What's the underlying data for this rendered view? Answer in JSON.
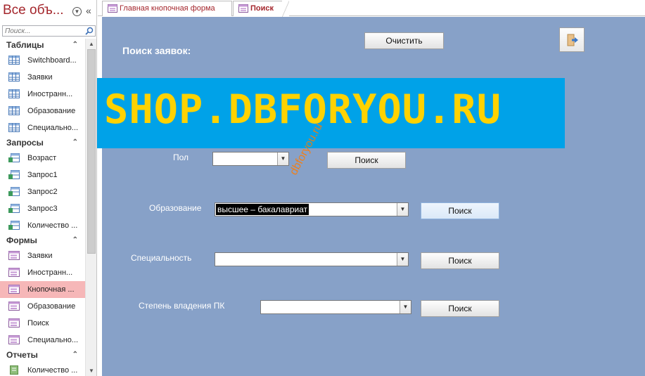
{
  "nav": {
    "title": "Все объ...",
    "search_placeholder": "Поиск...",
    "groups": [
      {
        "label": "Таблицы",
        "items": [
          "Switchboard...",
          "Заявки",
          "Иностранн...",
          "Образование",
          "Специально..."
        ]
      },
      {
        "label": "Запросы",
        "items": [
          "Возраст",
          "Запрос1",
          "Запрос2",
          "Запрос3",
          "Количество ..."
        ]
      },
      {
        "label": "Формы",
        "items": [
          "Заявки",
          "Иностранн...",
          "Кнопочная ...",
          "Образование",
          "Поиск",
          "Специально..."
        ]
      },
      {
        "label": "Отчеты",
        "items": [
          "Количество ..."
        ]
      }
    ],
    "selected_item": "Кнопочная ..."
  },
  "tabs": [
    {
      "label": "Главная кнопочная форма",
      "active": false
    },
    {
      "label": "Поиск",
      "active": true
    }
  ],
  "form": {
    "title": "Поиск заявок:",
    "clear_button": "Очистить",
    "exit_icon": "exit-door-icon",
    "fields": [
      {
        "label": "Пол",
        "value": "",
        "button": "Поиск"
      },
      {
        "label": "Образование",
        "value": "высшее – бакалавриат",
        "button": "Поиск"
      },
      {
        "label": "Специальность",
        "value": "",
        "button": "Поиск"
      },
      {
        "label": "Степень владения ПК",
        "value": "",
        "button": "Поиск"
      }
    ]
  },
  "watermark": {
    "banner": "SHOP.DBFORYOU.RU",
    "diagonal": "dbforyou.ru"
  },
  "colors": {
    "form_bg": "#87a1c8",
    "accent": "#a4262c",
    "selected_nav": "#f6b7b8",
    "banner_bg": "#00a2e8",
    "banner_text": "#ffd200"
  }
}
